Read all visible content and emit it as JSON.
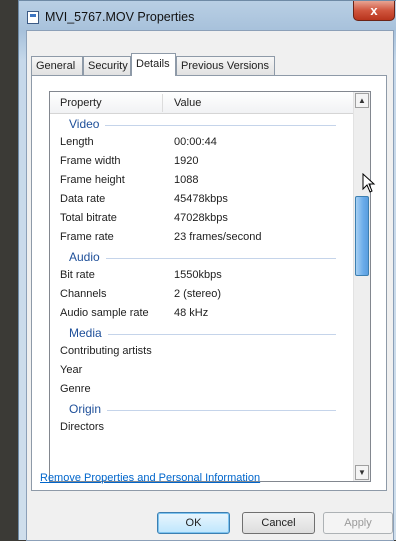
{
  "window": {
    "title": "MVI_5767.MOV Properties",
    "close_label": "x"
  },
  "tabs": [
    {
      "label": "General",
      "active": false
    },
    {
      "label": "Security",
      "active": false
    },
    {
      "label": "Details",
      "active": true
    },
    {
      "label": "Previous Versions",
      "active": false
    }
  ],
  "list": {
    "col_property": "Property",
    "col_value": "Value",
    "scroll_up": "▲",
    "scroll_down": "▼",
    "groups": {
      "video": "Video",
      "audio": "Audio",
      "media": "Media",
      "origin": "Origin"
    },
    "rows": {
      "length": {
        "name": "Length",
        "value": "00:00:44"
      },
      "frame_width": {
        "name": "Frame width",
        "value": "1920"
      },
      "frame_height": {
        "name": "Frame height",
        "value": "1088"
      },
      "data_rate": {
        "name": "Data rate",
        "value": "45478kbps"
      },
      "total_bitrate": {
        "name": "Total bitrate",
        "value": "47028kbps"
      },
      "frame_rate": {
        "name": "Frame rate",
        "value": "23 frames/second"
      },
      "bit_rate": {
        "name": "Bit rate",
        "value": "1550kbps"
      },
      "channels": {
        "name": "Channels",
        "value": "2 (stereo)"
      },
      "audio_sample_rate": {
        "name": "Audio sample rate",
        "value": "48 kHz"
      },
      "contributing_artists": {
        "name": "Contributing artists",
        "value": ""
      },
      "year": {
        "name": "Year",
        "value": ""
      },
      "genre": {
        "name": "Genre",
        "value": ""
      },
      "directors": {
        "name": "Directors",
        "value": ""
      }
    }
  },
  "remove_link": "Remove Properties and Personal Information",
  "buttons": {
    "ok": "OK",
    "cancel": "Cancel",
    "apply": "Apply"
  }
}
